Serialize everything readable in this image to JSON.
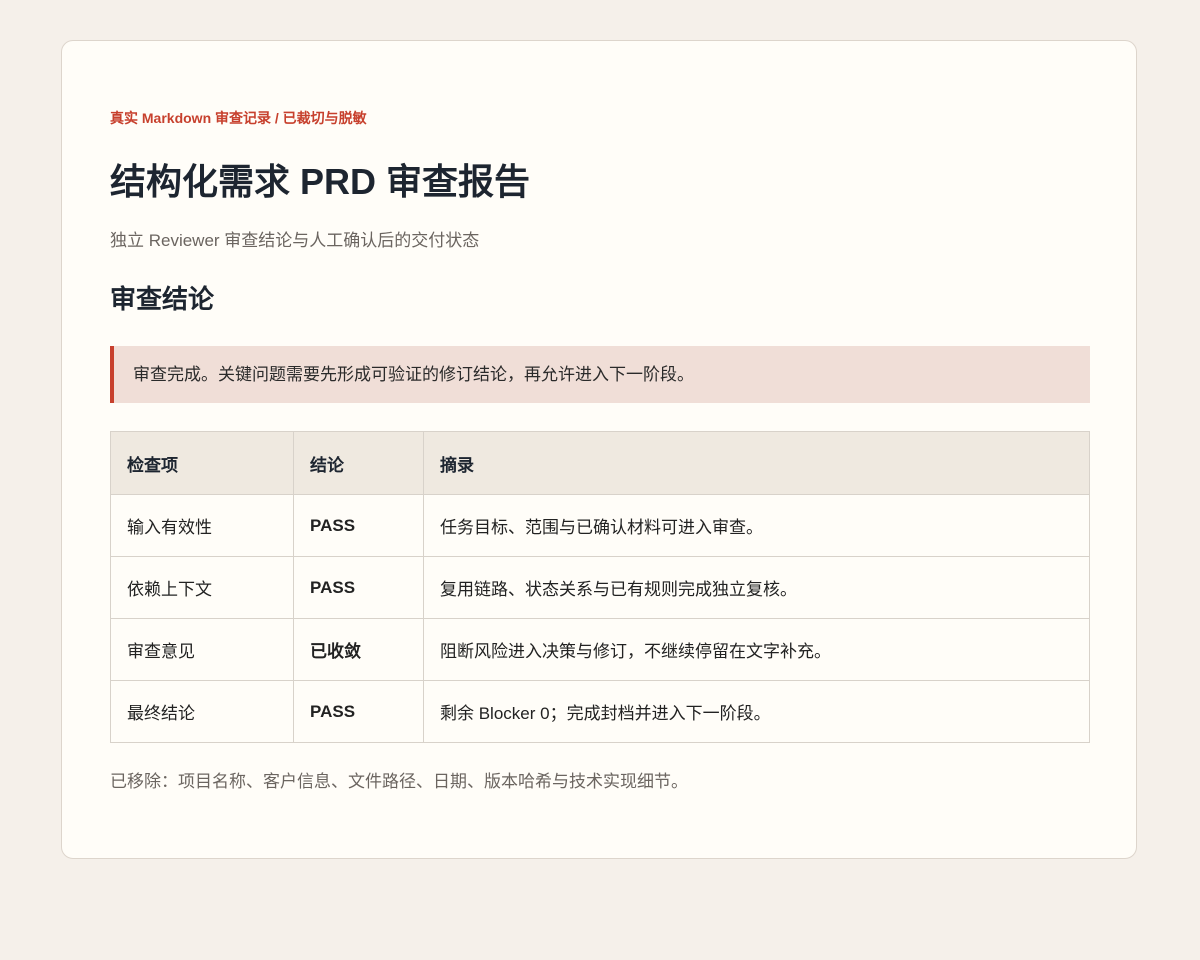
{
  "header": {
    "eyebrow": "真实 Markdown 审查记录 / 已裁切与脱敏",
    "title": "结构化需求 PRD 审查报告",
    "subtitle": "独立 Reviewer 审查结论与人工确认后的交付状态"
  },
  "section": {
    "heading": "审查结论",
    "callout": "审查完成。关键问题需要先形成可验证的修订结论，再允许进入下一阶段。"
  },
  "table": {
    "headers": [
      "检查项",
      "结论",
      "摘录"
    ],
    "rows": [
      {
        "item": "输入有效性",
        "verdict": "PASS",
        "excerpt": "任务目标、范围与已确认材料可进入审查。"
      },
      {
        "item": "依赖上下文",
        "verdict": "PASS",
        "excerpt": "复用链路、状态关系与已有规则完成独立复核。"
      },
      {
        "item": "审查意见",
        "verdict": "已收敛",
        "excerpt": "阻断风险进入决策与修订，不继续停留在文字补充。"
      },
      {
        "item": "最终结论",
        "verdict": "PASS",
        "excerpt": "剩余 Blocker 0；完成封档并进入下一阶段。"
      }
    ]
  },
  "footnote": "已移除：项目名称、客户信息、文件路径、日期、版本哈希与技术实现细节。",
  "colors": {
    "accent": "#c7402d",
    "verdict": "#236c58",
    "callout_bg": "#f0ded7",
    "page_bg": "#f5f0ea",
    "card_bg": "#fffdf8"
  }
}
